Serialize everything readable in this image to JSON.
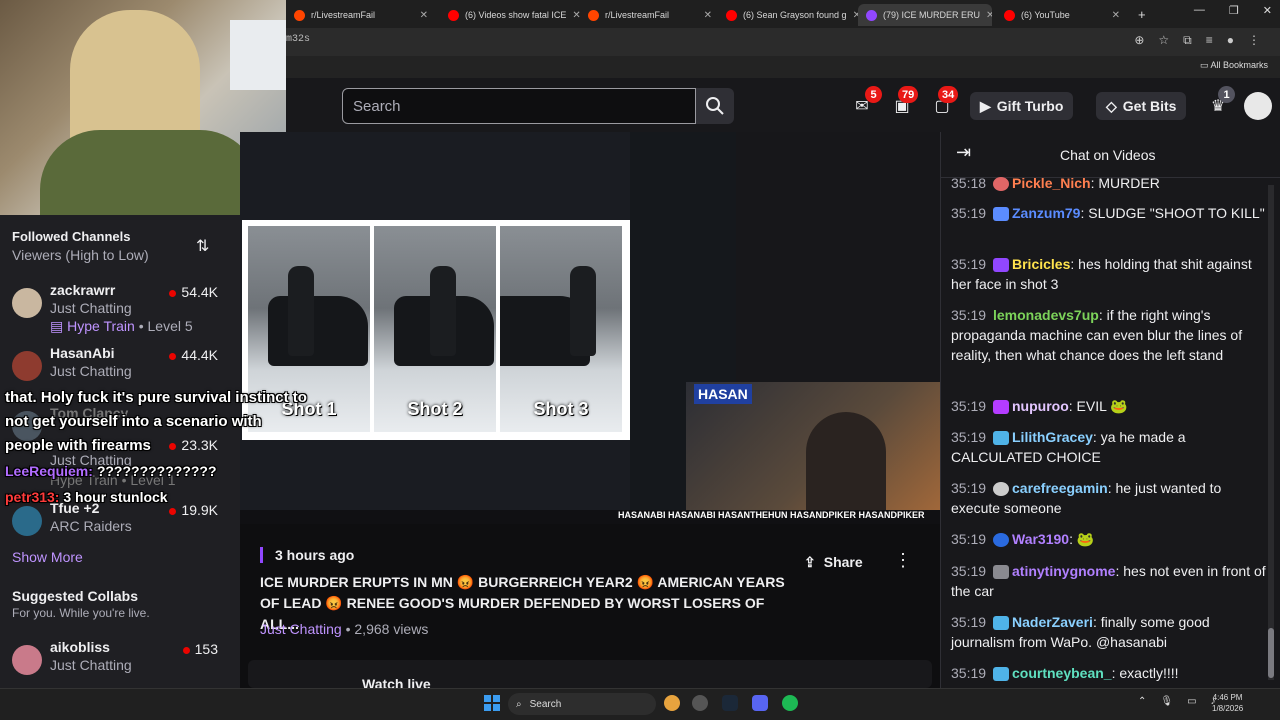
{
  "browser": {
    "tabs": [
      {
        "label": "r/LivestreamFail",
        "icon_color": "#ff4500"
      },
      {
        "label": "(6) Videos show fatal ICE",
        "icon_color": "#ff0000"
      },
      {
        "label": "r/LivestreamFail",
        "icon_color": "#ff4500"
      },
      {
        "label": "(6) Sean Grayson found g",
        "icon_color": "#ff0000"
      },
      {
        "label": "(79) ICE MURDER ERU",
        "icon_color": "#9147ff"
      },
      {
        "label": "(6) YouTube",
        "icon_color": "#ff0000"
      }
    ],
    "new_tab": "+",
    "url": "m32s",
    "bookmarks_label": "All Bookmarks",
    "window_controls": [
      "⌄",
      "—",
      "❐",
      "✕"
    ]
  },
  "header": {
    "search_placeholder": "Search",
    "inbox_badge": "5",
    "notif_badge": "79",
    "whispers_badge": "34",
    "gift_turbo": "Gift Turbo",
    "get_bits": "Get Bits",
    "bits_badge": "1"
  },
  "sidebar": {
    "followed_title": "Followed Channels",
    "followed_sub": "Viewers (High to Low)",
    "channels": [
      {
        "name": "zackrawrr",
        "category": "Just Chatting",
        "viewers": "54.4K",
        "extra_badge": "Hype Train",
        "extra_level": "• Level 5",
        "avatar_color": "#c9b7a0"
      },
      {
        "name": "HasanAbi",
        "category": "Just Chatting",
        "viewers": "44.4K",
        "avatar_color": "#8e3b2f"
      },
      {
        "name": "Tom Clancy",
        "category": "Just Chatting",
        "viewers": "23.3K",
        "avatar_color": "#4a5560"
      },
      {
        "name": "",
        "category": "Just Chatting",
        "viewers": "",
        "extra_badge": "Hype Train",
        "extra_level": "• Level 1",
        "avatar_color": "#5a4a70"
      },
      {
        "name": "Tfue +2",
        "category": "ARC Raiders",
        "viewers": "19.9K",
        "avatar_color": "#2a6a8a"
      }
    ],
    "show_more": "Show More",
    "collabs_title": "Suggested Collabs",
    "collabs_sub": "For you. While you're live.",
    "collab": {
      "name": "aikobliss",
      "category": "Just Chatting",
      "viewers": "153",
      "avatar_color": "#c97a8a"
    }
  },
  "overlay": {
    "caption_lines": [
      "that. Holy fuck it's pure survival instinct to",
      "not get yourself into a scenario with",
      "people with firearms"
    ],
    "chat_lines": [
      {
        "user": "LeeRequiem:",
        "text": "??????????????",
        "color": "#b16cff"
      },
      {
        "user": "petr313:",
        "text": "3 hour stunlock",
        "color": "#ff3b3b"
      }
    ]
  },
  "video": {
    "shot_labels": [
      "Shot 1",
      "Shot 2",
      "Shot 3"
    ],
    "handles": "HASANABI  HASANABI  HASANTHEHUN  HASANDPIKER  HASANDPIKER",
    "cam_label": "HASAN"
  },
  "info": {
    "time_ago": "3 hours ago",
    "share": "Share",
    "title": "ICE MURDER ERUPTS IN MN 😡 BURGERREICH YEAR2 😡 AMERICAN YEARS OF LEAD 😡 RENEE GOOD'S MURDER DEFENDED BY WORST LOSERS OF ALL...",
    "category": "Just Chatting",
    "views": " • 2,968 views",
    "watch_live": "Watch live"
  },
  "chat": {
    "title": "Chat on Videos",
    "messages": [
      {
        "ts": "35:18",
        "user": "Pickle_Nich",
        "text": ": MURDER",
        "color": "#ff7f50",
        "badge": "#e06666"
      },
      {
        "ts": "35:19",
        "user": "Zanzum79",
        "text": ": SLUDGE \"SHOOT TO KILL\"",
        "color": "#5b8cff",
        "badge": "#5b8cff"
      },
      {
        "ts": "35:19",
        "user": "Bricicles",
        "text": ": hes holding that shit against her face in shot 3",
        "color": "#ffe34d",
        "badge": "#9147ff"
      },
      {
        "ts": "35:19",
        "user": "lemonadevs7up",
        "text": ": if the right wing's propaganda machine can even blur the lines of reality, then what chance does the left stand",
        "color": "#7cd35a",
        "badge": ""
      },
      {
        "ts": "35:19",
        "user": "nupuroo",
        "text": ": EVIL 🐸",
        "color": "#e3c6ff",
        "badge": "#b43cff"
      },
      {
        "ts": "35:19",
        "user": "LilithGracey",
        "text": ": ya he made a CALCULATED CHOICE",
        "color": "#8ad0ff",
        "badge": "#4fb3e8"
      },
      {
        "ts": "35:19",
        "user": "carefreegamin",
        "text": ": he just wanted to execute someone",
        "color": "#8ad0ff",
        "badge": "#cccccc"
      },
      {
        "ts": "35:19",
        "user": "War3190",
        "text": ": 🐸",
        "color": "#b180ff",
        "badge": "#2a6adf"
      },
      {
        "ts": "35:19",
        "user": "atinytinygnome",
        "text": ": hes not even in front of the car",
        "color": "#b180ff",
        "badge": "#8a8a90"
      },
      {
        "ts": "35:19",
        "user": "NaderZaveri",
        "text": ": finally some good journalism from WaPo. @hasanabi",
        "color": "#8ad0ff",
        "badge": "#4fb3e8"
      },
      {
        "ts": "35:19",
        "user": "courtneybean_",
        "text": ": exactly!!!!",
        "color": "#5fe0c0",
        "badge": "#4fb3e8"
      }
    ]
  },
  "taskbar": {
    "search": "Search",
    "time": "4:46 PM",
    "date": "1/8/2026"
  }
}
